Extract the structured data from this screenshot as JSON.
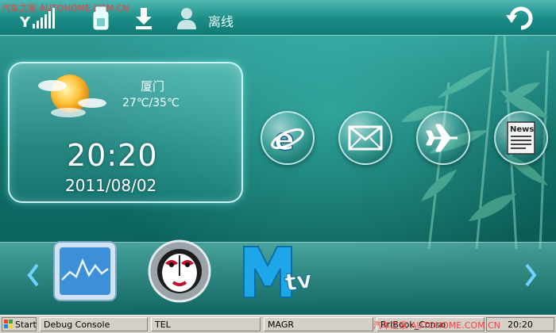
{
  "watermark": {
    "top_left": "汽车之家 AUTOHOME.COM.CN",
    "bottom_right": "汽车之家 AUTOHOME.COM.CN"
  },
  "topbar": {
    "icons": [
      "signal-icon",
      "sim-card-icon",
      "download-icon",
      "user-icon"
    ],
    "status_label": "离线",
    "back_icon": "back-arrow-icon"
  },
  "weather": {
    "city": "厦门",
    "temperature": "27℃/35℃",
    "time": "20:20",
    "date": "2011/08/02",
    "icon": "partly-cloudy-icon"
  },
  "apps": [
    {
      "name": "browser",
      "icon": "internet-explorer-icon"
    },
    {
      "name": "mail",
      "icon": "mail-icon"
    },
    {
      "name": "flight",
      "icon": "airplane-icon"
    },
    {
      "name": "news",
      "icon": "news-icon",
      "label": "News"
    }
  ],
  "dock": {
    "apps": [
      {
        "name": "monitor",
        "icon": "waveform-monitor-icon"
      },
      {
        "name": "opera-mask",
        "icon": "opera-mask-icon"
      },
      {
        "name": "mtv",
        "icon": "mtv-icon"
      }
    ]
  },
  "taskbar": {
    "start_label": "Start",
    "items": [
      "Debug Console",
      "TEL",
      "MAGR",
      "RrIBook_Conso"
    ],
    "clock": "20:20"
  },
  "colors": {
    "background": "#0f6f6a",
    "topbar": "#1a8b86",
    "taskbar": "#d4d0c8",
    "watermark": "#ff3b3b"
  }
}
